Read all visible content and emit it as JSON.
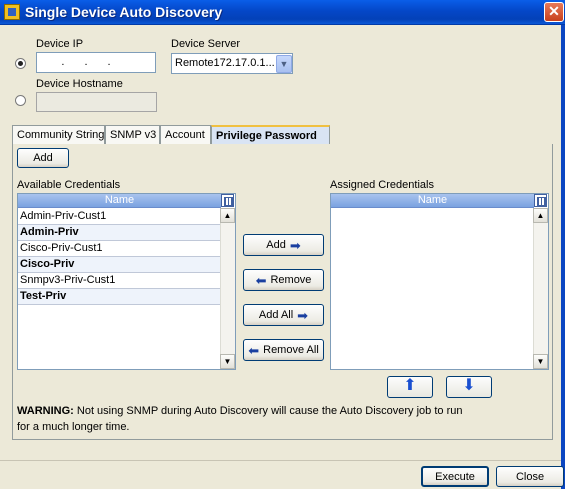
{
  "window": {
    "title": "Single Device Auto Discovery",
    "close_glyph": "✕"
  },
  "device_ip": {
    "label": "Device IP",
    "value": "   .    .    .   ",
    "selected": true
  },
  "device_server": {
    "label": "Device Server",
    "selected_value": "Remote172.17.0.1..."
  },
  "device_hostname": {
    "label": "Device Hostname",
    "value": "",
    "selected": false
  },
  "tabs": [
    {
      "label": "Community String",
      "active": false
    },
    {
      "label": "SNMP v3",
      "active": false
    },
    {
      "label": "Account",
      "active": false
    },
    {
      "label": "Privilege Password",
      "active": true
    }
  ],
  "add_button": "Add",
  "available": {
    "label": "Available Credentials",
    "column": "Name",
    "rows": [
      {
        "name": "Admin-Priv-Cust1",
        "bold": false
      },
      {
        "name": "Admin-Priv",
        "bold": true
      },
      {
        "name": "Cisco-Priv-Cust1",
        "bold": false
      },
      {
        "name": "Cisco-Priv",
        "bold": true
      },
      {
        "name": "Snmpv3-Priv-Cust1",
        "bold": false
      },
      {
        "name": "Test-Priv",
        "bold": true
      }
    ]
  },
  "assigned": {
    "label": "Assigned Credentials",
    "column": "Name",
    "rows": []
  },
  "transfer": {
    "add": "Add",
    "remove": "Remove",
    "add_all": "Add All",
    "remove_all": "Remove All",
    "right_arrow": "➡",
    "left_arrow": "⬅"
  },
  "order": {
    "up_arrow": "⬆",
    "down_arrow": "⬇"
  },
  "warning": {
    "prefix": "WARNING:",
    "line1": " Not using SNMP during Auto Discovery will cause the Auto Discovery job to run",
    "line2": "for a much longer time."
  },
  "footer": {
    "execute": "Execute",
    "close": "Close"
  },
  "icons": {
    "scroll_up": "▲",
    "scroll_down": "▼",
    "dropdown": "▼"
  }
}
